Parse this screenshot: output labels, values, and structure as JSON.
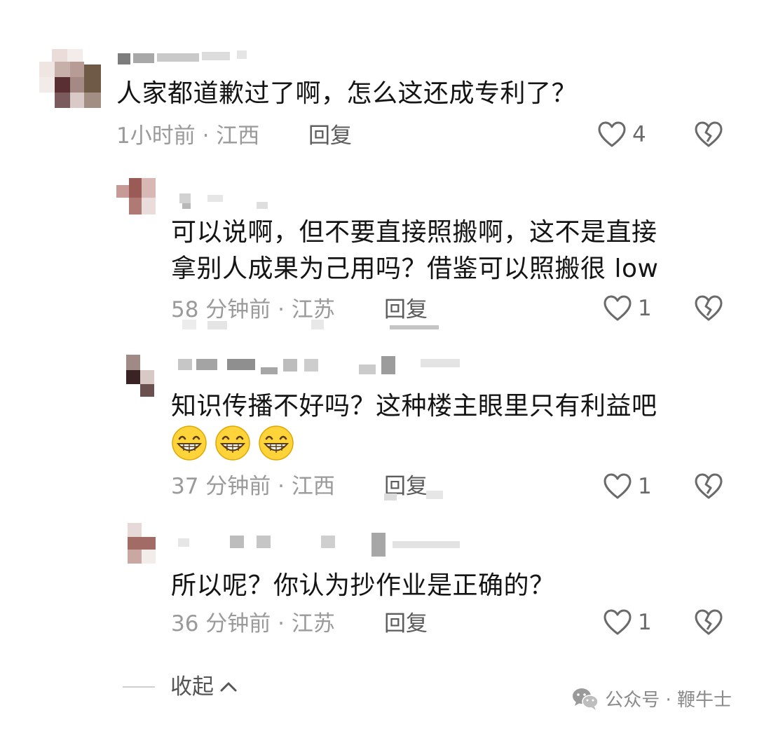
{
  "comments": [
    {
      "text": "人家都道歉过了啊，怎么这还成专利了？",
      "meta": "1小时前 · 江西",
      "reply_label": "回复",
      "likes": "4"
    },
    {
      "text_line1": "可以说啊，但不要直接照搬啊，这不是直接",
      "text_line2": "拿别人成果为己用吗？借鉴可以照搬很 low",
      "meta": "58 分钟前 · 江苏",
      "reply_label": "回复",
      "likes": "1"
    },
    {
      "text_line1": "知识传播不好吗？这种楼主眼里只有利益吧",
      "emojis": [
        "grin-emoji",
        "grin-emoji",
        "grin-emoji"
      ],
      "meta": "37 分钟前 · 江西",
      "reply_label": "回复",
      "likes": "1"
    },
    {
      "text": "所以呢？你认为抄作业是正确的？",
      "meta": "36 分钟前 · 江苏",
      "reply_label": "回复",
      "likes": "1"
    }
  ],
  "collapse_label": "收起",
  "watermark": "公众号 · 鞭牛士",
  "colors": {
    "text": "#141414",
    "meta": "#9a9a9a",
    "icon": "#6a6a6a"
  }
}
